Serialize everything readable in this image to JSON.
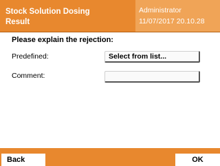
{
  "header": {
    "title_line1": "Stock Solution Dosing",
    "title_line2": "Result",
    "user": "Administrator",
    "datetime": "11/07/2017 20.10.28"
  },
  "form": {
    "heading": "Please explain the rejection:",
    "predefined_label": "Predefined:",
    "predefined_value": "Select from list...",
    "comment_label": "Comment:",
    "comment_value": ""
  },
  "footer": {
    "back_label": "Back",
    "ok_label": "OK"
  },
  "colors": {
    "header_bg": "#e8882e",
    "header_user_bg": "#f0a457",
    "footer_bg": "#e8882e"
  }
}
